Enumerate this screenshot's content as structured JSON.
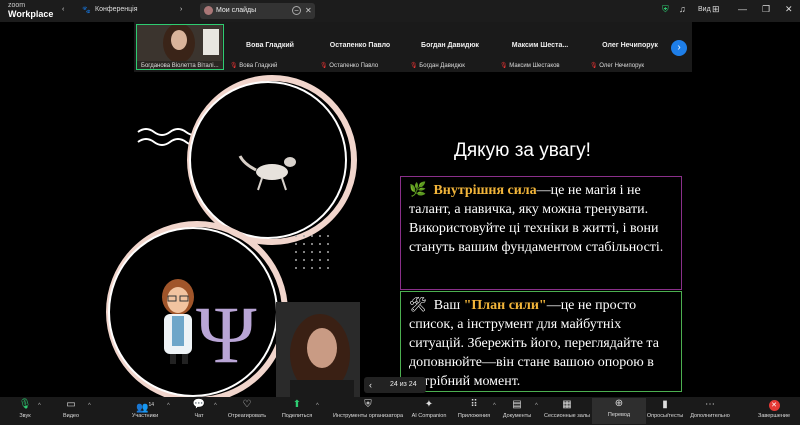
{
  "app": {
    "logo_line1": "zoom",
    "logo_line2": "Workplace",
    "meeting_label": "Конференція"
  },
  "tab": {
    "title": "Мои слайды"
  },
  "window": {
    "view_label": "Вид"
  },
  "participants": [
    {
      "name": "",
      "label": "Богданова Віолетта Віталі..."
    },
    {
      "name": "Вова Гладкий",
      "label": "Вова Гладкий"
    },
    {
      "name": "Остапенко Павло",
      "label": "Остапенко Павло"
    },
    {
      "name": "Богдан Давидюк",
      "label": "Богдан Давидюк"
    },
    {
      "name": "Максим  Шеста...",
      "label": "Максим Шестаков"
    },
    {
      "name": "Олег Нечипорук",
      "label": "Олег Нечипорук"
    }
  ],
  "slide": {
    "title": "Дякую за увагу!",
    "box1": {
      "emoji": "🌿",
      "highlight": "Внутрішня сила",
      "text": "—це не магія і не талант, а навичка, яку можна тренувати. Використовуйте ці техніки в житті, і вони стануть вашим фундаментом стабільності."
    },
    "box2": {
      "emoji": "🛠",
      "lead": "Ваш ",
      "highlight": "\"План сили\"",
      "text": "—це не просто список, а інструмент для майбутніх ситуацій. Збережіть його, переглядайте та доповнюйте—він стане вашою опорою в потрібний момент."
    }
  },
  "pager": {
    "label": "24 из 24"
  },
  "toolbar": [
    {
      "icon": "mic-icon",
      "glyph": "🎙",
      "label": "Звук"
    },
    {
      "icon": "video-icon",
      "glyph": "▭",
      "label": "Видео"
    },
    {
      "icon": "participants-icon",
      "glyph": "👥",
      "label": "Участники",
      "badge": "14"
    },
    {
      "icon": "chat-icon",
      "glyph": "💬",
      "label": "Чат"
    },
    {
      "icon": "react-icon",
      "glyph": "♡",
      "label": "Отреагировать"
    },
    {
      "icon": "share-icon",
      "glyph": "⬆",
      "label": "Поделиться"
    },
    {
      "icon": "host-tools-icon",
      "glyph": "⛨",
      "label": "Инструменты организатора"
    },
    {
      "icon": "ai-companion-icon",
      "glyph": "✦",
      "label": "AI Companion"
    },
    {
      "icon": "apps-icon",
      "glyph": "⠿",
      "label": "Приложения"
    },
    {
      "icon": "docs-icon",
      "glyph": "▤",
      "label": "Документы"
    },
    {
      "icon": "breakout-icon",
      "glyph": "▦",
      "label": "Сессионные залы"
    },
    {
      "icon": "translate-icon",
      "glyph": "⊕",
      "label": "Перевод"
    },
    {
      "icon": "polls-icon",
      "glyph": "▮",
      "label": "Опросы/тесты"
    },
    {
      "icon": "more-icon",
      "glyph": "⋯",
      "label": "Дополнительно"
    },
    {
      "icon": "end-icon",
      "glyph": "✕",
      "label": "Завершение"
    }
  ],
  "colors": {
    "accent_green": "#2ecc71",
    "accent_blue": "#1e7ee8",
    "highlight": "#f2b53a",
    "box1_border": "#8a2f8a",
    "box2_border": "#4caf50",
    "end_red": "#e53935"
  }
}
